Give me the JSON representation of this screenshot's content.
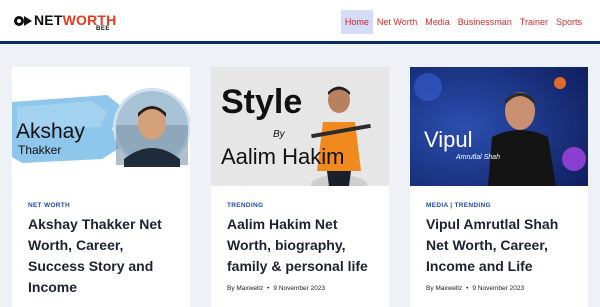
{
  "header": {
    "logo": {
      "text_net": "NET",
      "text_worth": "WORTH",
      "text_bee": "BEE"
    },
    "nav": [
      {
        "label": "Home",
        "active": true
      },
      {
        "label": "Net Worth",
        "active": false
      },
      {
        "label": "Media",
        "active": false
      },
      {
        "label": "Businessman",
        "active": false
      },
      {
        "label": "Trainer",
        "active": false
      },
      {
        "label": "Sports",
        "active": false
      }
    ]
  },
  "cards": [
    {
      "image_text_1": "Akshay",
      "image_text_2": "Thakker",
      "category": "NET WORTH",
      "title": "Akshay Thakker Net Worth, Career, Success Story and Income",
      "author": "",
      "date": ""
    },
    {
      "image_text_1": "Style",
      "image_text_2": "By",
      "image_text_3": "Aalim Hakim",
      "category": "TRENDING",
      "title": "Aalim Hakim Net Worth, biography, family & personal life",
      "author": "By Maxwellz",
      "date": "9 November 2023"
    },
    {
      "image_text_1": "Vipul",
      "image_text_2": "Amrutlal Shah",
      "category": "MEDIA | TRENDING",
      "title": "Vipul Amrutlal Shah Net Worth, Career, Income and Life",
      "author": "By Maxwellz",
      "date": "9 November 2023"
    }
  ],
  "colors": {
    "accent_red": "#e53a1f",
    "nav_red": "#d12d2d",
    "category_blue": "#1f4aa8",
    "header_border": "#0b2f5c"
  }
}
